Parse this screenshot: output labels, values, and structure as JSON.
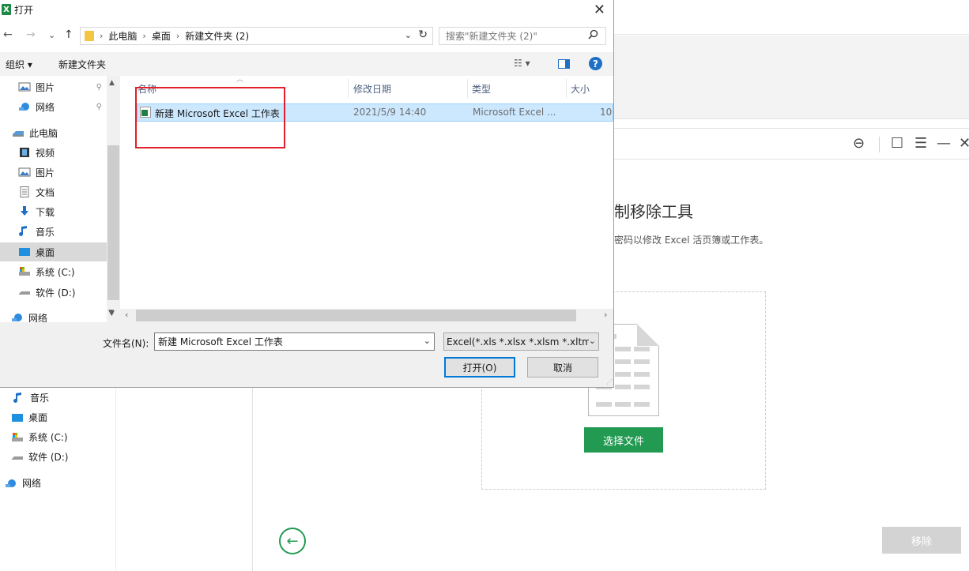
{
  "dialog": {
    "title": "打开",
    "close_glyph": "✕",
    "nav": {
      "back": "←",
      "forward": "→",
      "recent": "⌄",
      "up": "↑"
    },
    "breadcrumb": [
      "此电脑",
      "桌面",
      "新建文件夹 (2)"
    ],
    "breadcrumb_sep": "›",
    "address_dropdown": "⌄",
    "refresh_glyph": "↻",
    "search_placeholder": "搜索\"新建文件夹 (2)\"",
    "search_glyph": "⚲",
    "toolbar": {
      "organize": "组织 ▾",
      "new_folder": "新建文件夹",
      "view_glyph": "☷ ▾",
      "help": "?"
    },
    "nav_items": [
      {
        "label": "图片",
        "icon": "pictures-icon",
        "pinned": true
      },
      {
        "label": "网络",
        "icon": "network-icon",
        "pinned": true
      },
      {
        "label": "此电脑",
        "icon": "computer-icon",
        "pinned": false
      },
      {
        "label": "视频",
        "icon": "video-icon",
        "pinned": false
      },
      {
        "label": "图片",
        "icon": "pictures-icon",
        "pinned": false
      },
      {
        "label": "文档",
        "icon": "document-icon",
        "pinned": false
      },
      {
        "label": "下载",
        "icon": "download-icon",
        "pinned": false
      },
      {
        "label": "音乐",
        "icon": "music-icon",
        "pinned": false
      },
      {
        "label": "桌面",
        "icon": "desktop-icon",
        "pinned": false,
        "selected": true
      },
      {
        "label": "系统 (C:)",
        "icon": "system-drive-icon",
        "pinned": false
      },
      {
        "label": "软件 (D:)",
        "icon": "drive-icon",
        "pinned": false
      },
      {
        "label": "网络",
        "icon": "network-icon",
        "pinned": false
      }
    ],
    "pin_glyph": "📌",
    "columns": {
      "name": "名称",
      "modified": "修改日期",
      "type": "类型",
      "size": "大小"
    },
    "files": [
      {
        "name": "新建 Microsoft Excel 工作表",
        "modified": "2021/5/9 14:40",
        "type": "Microsoft Excel ...",
        "size": "10"
      }
    ],
    "filename_label": "文件名(N):",
    "filename_value": "新建 Microsoft Excel 工作表",
    "filetype_value": "Excel(*.xls *.xlsx *.xlsm *.xltm",
    "open_button": "打开(O)",
    "cancel_button": "取消"
  },
  "background": {
    "title_fragment": "制移除工具",
    "subtitle_fragment": "密码以修改 Excel 活页簿或工作表。",
    "choose_file_button": "选择文件",
    "remove_button": "移除",
    "back_glyph": "←",
    "header_icons": {
      "user": "⊖",
      "feedback": "☐",
      "menu": "☰",
      "minimize": "—",
      "close": "✕"
    },
    "left_nav": [
      {
        "label": "音乐",
        "icon": "music-icon"
      },
      {
        "label": "桌面",
        "icon": "desktop-icon"
      },
      {
        "label": "系统 (C:)",
        "icon": "system-drive-icon"
      },
      {
        "label": "软件 (D:)",
        "icon": "drive-icon"
      },
      {
        "label": "网络",
        "icon": "network-icon"
      }
    ]
  },
  "colors": {
    "accent_green": "#229a52",
    "highlight_red": "#e21f2a",
    "selection_blue": "#cce8ff",
    "windows_blue": "#0078d7"
  }
}
